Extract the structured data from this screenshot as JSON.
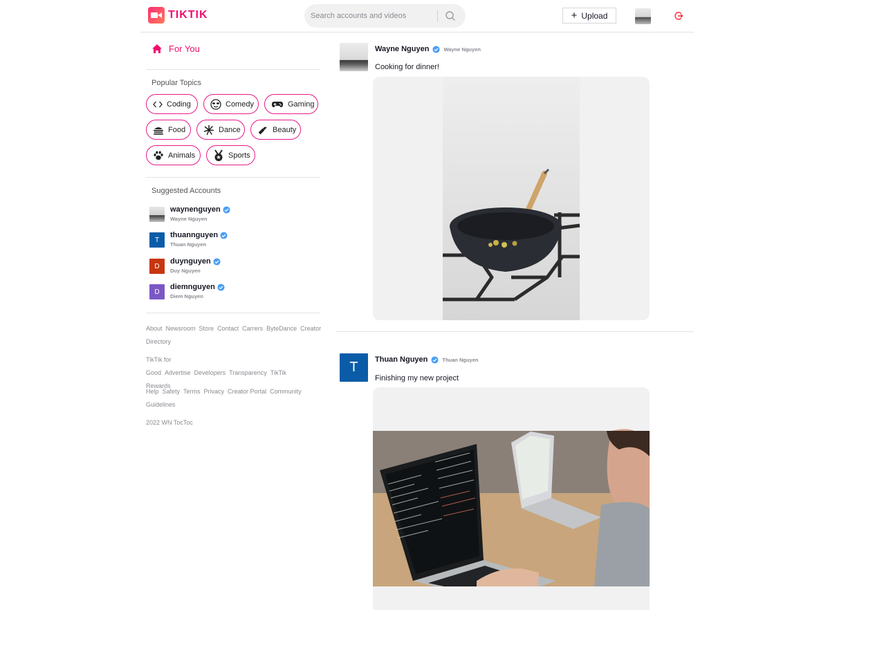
{
  "header": {
    "logo_text": "TIKTIK",
    "search_placeholder": "Search accounts and videos",
    "upload_label": "Upload"
  },
  "sidebar": {
    "for_you_label": "For You",
    "popular_topics_title": "Popular Topics",
    "topics": [
      {
        "label": "Coding",
        "icon": "code-icon"
      },
      {
        "label": "Comedy",
        "icon": "sunglasses-face-icon"
      },
      {
        "label": "Gaming",
        "icon": "gamepad-icon"
      },
      {
        "label": "Food",
        "icon": "food-icon"
      },
      {
        "label": "Dance",
        "icon": "dance-icon"
      },
      {
        "label": "Beauty",
        "icon": "lipstick-icon"
      },
      {
        "label": "Animals",
        "icon": "paw-icon"
      },
      {
        "label": "Sports",
        "icon": "medal-icon"
      }
    ],
    "suggested_title": "Suggested Accounts",
    "accounts": [
      {
        "username": "waynenguyen",
        "name": "Wayne Nguyen",
        "initial": "",
        "color": "#9a9a9a"
      },
      {
        "username": "thuannguyen",
        "name": "Thuan Nguyen",
        "initial": "T",
        "color": "#0a5ca8"
      },
      {
        "username": "duynguyen",
        "name": "Duy Nguyen",
        "initial": "D",
        "color": "#c7360f"
      },
      {
        "username": "diemnguyen",
        "name": "Diem Nguyen",
        "initial": "D",
        "color": "#7b57c5"
      }
    ],
    "footer_groups": [
      [
        "About",
        "Newsroom",
        "Store",
        "Contact",
        "Carrers",
        "ByteDance",
        "Creator Directory"
      ],
      [
        "TikTik for Good",
        "Advertise",
        "Developers",
        "Transparency",
        "TikTik Rewards"
      ],
      [
        "Help",
        "Safety",
        "Terms",
        "Privacy",
        "Creator Portal",
        "Community Guidelines"
      ]
    ],
    "copyright": "2022 WN TocToc"
  },
  "feed": {
    "posts": [
      {
        "username": "Wayne Nguyen",
        "name": "Wayne Nguyen",
        "caption": "Cooking for dinner!",
        "avatar_initial": "",
        "avatar_color": "#9a9a9a"
      },
      {
        "username": "Thuan Nguyen",
        "name": "Thuan Nguyen",
        "caption": "Finishing my new project",
        "avatar_initial": "T",
        "avatar_color": "#0a5ca8"
      }
    ]
  },
  "colors": {
    "brand": "#f10f6f",
    "topic_border": "#e8198b",
    "verified": "#4a9ff5",
    "logout": "#ff2a3b"
  }
}
